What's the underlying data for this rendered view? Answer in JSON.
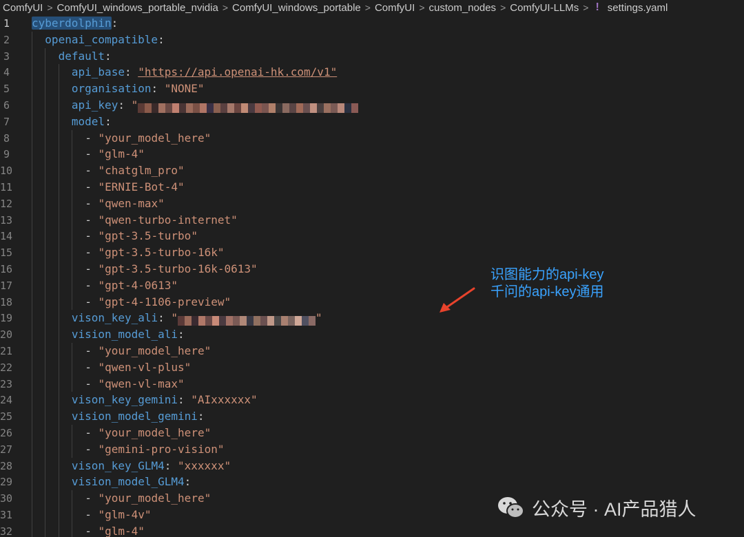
{
  "breadcrumb": {
    "items": [
      "ComfyUI",
      "ComfyUI_windows_portable_nvidia",
      "ComfyUI_windows_portable",
      "ComfyUI",
      "custom_nodes",
      "ComfyUI-LLMs"
    ],
    "file_icon": "!",
    "file": "settings.yaml"
  },
  "editor": {
    "active_line": 1,
    "lines": [
      {
        "n": "1",
        "indent": 0,
        "parts": [
          {
            "t": "cyberdolphin",
            "c": "k hl"
          },
          {
            "t": ":",
            "c": "p"
          }
        ]
      },
      {
        "n": "2",
        "indent": 1,
        "parts": [
          {
            "t": "openai_compatible",
            "c": "k"
          },
          {
            "t": ":",
            "c": "p"
          }
        ]
      },
      {
        "n": "3",
        "indent": 2,
        "parts": [
          {
            "t": "default",
            "c": "k"
          },
          {
            "t": ":",
            "c": "p"
          }
        ]
      },
      {
        "n": "4",
        "indent": 3,
        "parts": [
          {
            "t": "api_base",
            "c": "k"
          },
          {
            "t": ": ",
            "c": "p"
          },
          {
            "t": "\"https://api.openai-hk.com/v1\"",
            "c": "s url"
          }
        ]
      },
      {
        "n": "5",
        "indent": 3,
        "parts": [
          {
            "t": "organisation",
            "c": "k"
          },
          {
            "t": ": ",
            "c": "p"
          },
          {
            "t": "\"NONE\"",
            "c": "s"
          }
        ]
      },
      {
        "n": "6",
        "indent": 3,
        "parts": [
          {
            "t": "api_key",
            "c": "k"
          },
          {
            "t": ": ",
            "c": "p"
          },
          {
            "t": "\"",
            "c": "s"
          },
          {
            "blur": "api_key"
          }
        ]
      },
      {
        "n": "7",
        "indent": 3,
        "parts": [
          {
            "t": "model",
            "c": "k"
          },
          {
            "t": ":",
            "c": "p"
          }
        ]
      },
      {
        "n": "8",
        "indent": 4,
        "parts": [
          {
            "t": "- ",
            "c": "p"
          },
          {
            "t": "\"your_model_here\"",
            "c": "s"
          }
        ]
      },
      {
        "n": "9",
        "indent": 4,
        "parts": [
          {
            "t": "- ",
            "c": "p"
          },
          {
            "t": "\"glm-4\"",
            "c": "s"
          }
        ]
      },
      {
        "n": "10",
        "indent": 4,
        "parts": [
          {
            "t": "- ",
            "c": "p"
          },
          {
            "t": "\"chatglm_pro\"",
            "c": "s"
          }
        ]
      },
      {
        "n": "11",
        "indent": 4,
        "parts": [
          {
            "t": "- ",
            "c": "p"
          },
          {
            "t": "\"ERNIE-Bot-4\"",
            "c": "s"
          }
        ]
      },
      {
        "n": "12",
        "indent": 4,
        "parts": [
          {
            "t": "- ",
            "c": "p"
          },
          {
            "t": "\"qwen-max\"",
            "c": "s"
          }
        ]
      },
      {
        "n": "13",
        "indent": 4,
        "parts": [
          {
            "t": "- ",
            "c": "p"
          },
          {
            "t": "\"qwen-turbo-internet\"",
            "c": "s"
          }
        ]
      },
      {
        "n": "14",
        "indent": 4,
        "parts": [
          {
            "t": "- ",
            "c": "p"
          },
          {
            "t": "\"gpt-3.5-turbo\"",
            "c": "s"
          }
        ]
      },
      {
        "n": "15",
        "indent": 4,
        "parts": [
          {
            "t": "- ",
            "c": "p"
          },
          {
            "t": "\"gpt-3.5-turbo-16k\"",
            "c": "s"
          }
        ]
      },
      {
        "n": "16",
        "indent": 4,
        "parts": [
          {
            "t": "- ",
            "c": "p"
          },
          {
            "t": "\"gpt-3.5-turbo-16k-0613\"",
            "c": "s"
          }
        ]
      },
      {
        "n": "17",
        "indent": 4,
        "parts": [
          {
            "t": "- ",
            "c": "p"
          },
          {
            "t": "\"gpt-4-0613\"",
            "c": "s"
          }
        ]
      },
      {
        "n": "18",
        "indent": 4,
        "parts": [
          {
            "t": "- ",
            "c": "p"
          },
          {
            "t": "\"gpt-4-1106-preview\"",
            "c": "s"
          }
        ]
      },
      {
        "n": "19",
        "indent": 3,
        "parts": [
          {
            "t": "vison_key_ali",
            "c": "k"
          },
          {
            "t": ": ",
            "c": "p"
          },
          {
            "t": "\"",
            "c": "s"
          },
          {
            "blur": "ali_key"
          },
          {
            "t": "\"",
            "c": "s"
          }
        ]
      },
      {
        "n": "20",
        "indent": 3,
        "parts": [
          {
            "t": "vision_model_ali",
            "c": "k"
          },
          {
            "t": ":",
            "c": "p"
          }
        ]
      },
      {
        "n": "21",
        "indent": 4,
        "parts": [
          {
            "t": "- ",
            "c": "p"
          },
          {
            "t": "\"your_model_here\"",
            "c": "s"
          }
        ]
      },
      {
        "n": "22",
        "indent": 4,
        "parts": [
          {
            "t": "- ",
            "c": "p"
          },
          {
            "t": "\"qwen-vl-plus\"",
            "c": "s"
          }
        ]
      },
      {
        "n": "23",
        "indent": 4,
        "parts": [
          {
            "t": "- ",
            "c": "p"
          },
          {
            "t": "\"qwen-vl-max\"",
            "c": "s"
          }
        ]
      },
      {
        "n": "24",
        "indent": 3,
        "parts": [
          {
            "t": "vison_key_gemini",
            "c": "k"
          },
          {
            "t": ": ",
            "c": "p"
          },
          {
            "t": "\"AIxxxxxx\"",
            "c": "s"
          }
        ]
      },
      {
        "n": "25",
        "indent": 3,
        "parts": [
          {
            "t": "vision_model_gemini",
            "c": "k"
          },
          {
            "t": ":",
            "c": "p"
          }
        ]
      },
      {
        "n": "26",
        "indent": 4,
        "parts": [
          {
            "t": "- ",
            "c": "p"
          },
          {
            "t": "\"your_model_here\"",
            "c": "s"
          }
        ]
      },
      {
        "n": "27",
        "indent": 4,
        "parts": [
          {
            "t": "- ",
            "c": "p"
          },
          {
            "t": "\"gemini-pro-vision\"",
            "c": "s"
          }
        ]
      },
      {
        "n": "28",
        "indent": 3,
        "parts": [
          {
            "t": "vison_key_GLM4",
            "c": "k"
          },
          {
            "t": ": ",
            "c": "p"
          },
          {
            "t": "\"xxxxxx\"",
            "c": "s"
          }
        ]
      },
      {
        "n": "29",
        "indent": 3,
        "parts": [
          {
            "t": "vision_model_GLM4",
            "c": "k"
          },
          {
            "t": ":",
            "c": "p"
          }
        ]
      },
      {
        "n": "30",
        "indent": 4,
        "parts": [
          {
            "t": "- ",
            "c": "p"
          },
          {
            "t": "\"your_model_here\"",
            "c": "s"
          }
        ]
      },
      {
        "n": "31",
        "indent": 4,
        "parts": [
          {
            "t": "- ",
            "c": "p"
          },
          {
            "t": "\"glm-4v\"",
            "c": "s"
          }
        ]
      },
      {
        "n": "32",
        "indent": 4,
        "parts": [
          {
            "t": "- ",
            "c": "p"
          },
          {
            "t": "\"glm-4\"",
            "c": "s"
          }
        ]
      }
    ]
  },
  "redaction_colors": {
    "api_key": [
      "#5a3a35",
      "#8a5a4a",
      "#3a2a2a",
      "#a07060",
      "#6a4a45",
      "#c08070",
      "#4a3535",
      "#9a6a5a",
      "#7a5045",
      "#b07565",
      "#3a3045",
      "#8a6050",
      "#5a4040",
      "#a5786a",
      "#6a4540",
      "#c08a75",
      "#4a3a40",
      "#905a50",
      "#7a5550",
      "#b0806a",
      "#3a3535",
      "#8a6a60",
      "#5a4545",
      "#a06a58",
      "#6a5050",
      "#c09080",
      "#4a4040",
      "#9a7060",
      "#7a5a55",
      "#b8887a",
      "#2a3040",
      "#8a5a55"
    ],
    "ali_key": [
      "#5a3a38",
      "#9a6a5a",
      "#3a2a30",
      "#b07868",
      "#6a4a48",
      "#c88a78",
      "#4a3a40",
      "#a07065",
      "#7a5a55",
      "#b08878",
      "#3a3a45",
      "#907060",
      "#6a5050",
      "#c09888",
      "#4a4848",
      "#a88070",
      "#7a6560",
      "#d0a898",
      "#505060",
      "#8a6a65"
    ]
  },
  "annotation": {
    "line1": "识图能力的api-key",
    "line2": "千问的api-key通用",
    "color": "#3aa3ff",
    "arrow_color": "#e8432c"
  },
  "watermark": {
    "icon": "wechat-icon",
    "text": "公众号 · AI产品猎人"
  }
}
